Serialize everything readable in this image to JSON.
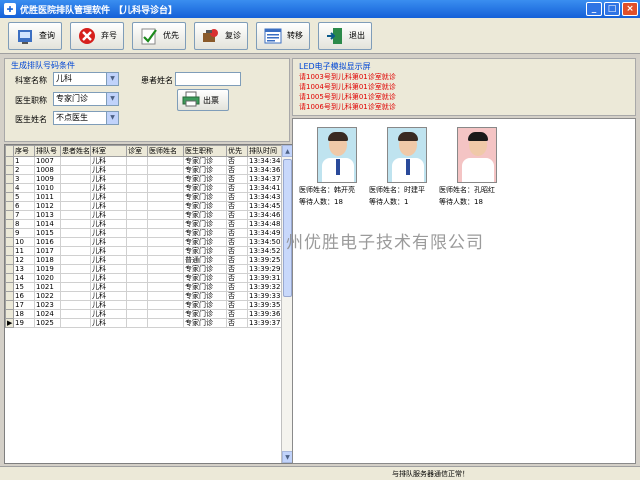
{
  "window": {
    "app_title": "优胜医院排队管理软件",
    "module_title": "【儿科导诊台】"
  },
  "toolbar": {
    "query": "查询",
    "call": "弃号",
    "priority": "优先",
    "recall": "复诊",
    "transfer": "转移",
    "exit": "退出"
  },
  "form": {
    "legend": "生成排队号码条件",
    "dept_label": "科室名称",
    "dept_value": "儿科",
    "title_label": "医生职称",
    "title_value": "专家门诊",
    "doctor_label": "医生姓名",
    "doctor_value": "不点医生",
    "patient_label": "患者姓名",
    "patient_value": "",
    "print_button": "出票"
  },
  "table": {
    "headers": [
      "序号",
      "排队号",
      "患者姓名",
      "科室",
      "诊室",
      "医师姓名",
      "医生职称",
      "优先",
      "排队时间"
    ],
    "rows": [
      [
        "1",
        "1007",
        "",
        "儿科",
        "",
        "",
        "专家门诊",
        "否",
        "13:34:34"
      ],
      [
        "2",
        "1008",
        "",
        "儿科",
        "",
        "",
        "专家门诊",
        "否",
        "13:34:36"
      ],
      [
        "3",
        "1009",
        "",
        "儿科",
        "",
        "",
        "专家门诊",
        "否",
        "13:34:37"
      ],
      [
        "4",
        "1010",
        "",
        "儿科",
        "",
        "",
        "专家门诊",
        "否",
        "13:34:41"
      ],
      [
        "5",
        "1011",
        "",
        "儿科",
        "",
        "",
        "专家门诊",
        "否",
        "13:34:43"
      ],
      [
        "6",
        "1012",
        "",
        "儿科",
        "",
        "",
        "专家门诊",
        "否",
        "13:34:45"
      ],
      [
        "7",
        "1013",
        "",
        "儿科",
        "",
        "",
        "专家门诊",
        "否",
        "13:34:46"
      ],
      [
        "8",
        "1014",
        "",
        "儿科",
        "",
        "",
        "专家门诊",
        "否",
        "13:34:48"
      ],
      [
        "9",
        "1015",
        "",
        "儿科",
        "",
        "",
        "专家门诊",
        "否",
        "13:34:49"
      ],
      [
        "10",
        "1016",
        "",
        "儿科",
        "",
        "",
        "专家门诊",
        "否",
        "13:34:50"
      ],
      [
        "11",
        "1017",
        "",
        "儿科",
        "",
        "",
        "专家门诊",
        "否",
        "13:34:52"
      ],
      [
        "12",
        "1018",
        "",
        "儿科",
        "",
        "",
        "普通门诊",
        "否",
        "13:39:25"
      ],
      [
        "13",
        "1019",
        "",
        "儿科",
        "",
        "",
        "专家门诊",
        "否",
        "13:39:29"
      ],
      [
        "14",
        "1020",
        "",
        "儿科",
        "",
        "",
        "专家门诊",
        "否",
        "13:39:31"
      ],
      [
        "15",
        "1021",
        "",
        "儿科",
        "",
        "",
        "专家门诊",
        "否",
        "13:39:32"
      ],
      [
        "16",
        "1022",
        "",
        "儿科",
        "",
        "",
        "专家门诊",
        "否",
        "13:39:33"
      ],
      [
        "17",
        "1023",
        "",
        "儿科",
        "",
        "",
        "专家门诊",
        "否",
        "13:39:35"
      ],
      [
        "18",
        "1024",
        "",
        "儿科",
        "",
        "",
        "专家门诊",
        "否",
        "13:39:36"
      ],
      [
        "19",
        "1025",
        "",
        "儿科",
        "",
        "",
        "专家门诊",
        "否",
        "13:39:37"
      ]
    ]
  },
  "led": {
    "legend": "LED电子模拟显示屏",
    "lines": [
      "请1003号到儿科第01诊室就诊",
      "请1004号到儿科第01诊室就诊",
      "请1005号到儿科第01诊室就诊",
      "请1006号到儿科第01诊室就诊"
    ]
  },
  "doctors": [
    {
      "name_line": "医师姓名：韩开亮",
      "wait_line": "等待人数：18"
    },
    {
      "name_line": "医师姓名：时建平",
      "wait_line": "等待人数：1"
    },
    {
      "name_line": "医师姓名：孔昭红",
      "wait_line": "等待人数：18"
    }
  ],
  "watermark": "州优胜电子技术有限公司",
  "status": {
    "text": "与排队服务器通信正常！"
  },
  "colors": {
    "title_bar": "#1460d8",
    "led_text": "#e00000",
    "legend": "#0046d5"
  },
  "icons": {
    "query": "query-icon",
    "call": "reject-icon",
    "priority": "check-icon",
    "recall": "recall-icon",
    "transfer": "transfer-icon",
    "exit": "exit-door-icon",
    "print": "printer-icon"
  }
}
